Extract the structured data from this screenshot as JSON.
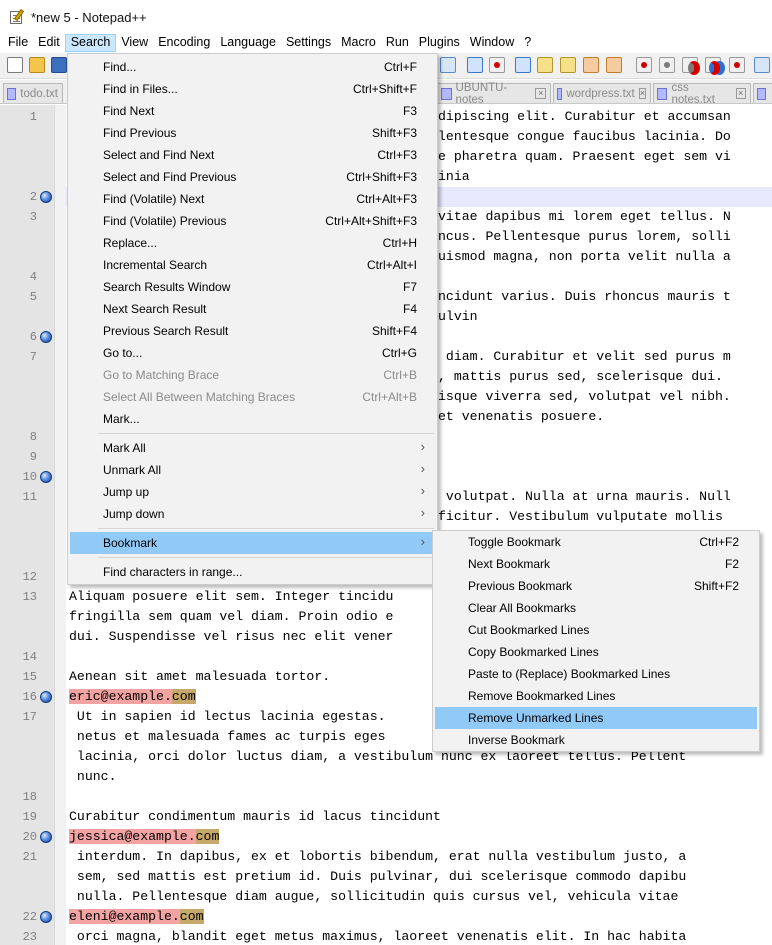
{
  "window": {
    "title": "*new 5 - Notepad++"
  },
  "menubar": [
    "File",
    "Edit",
    "Search",
    "View",
    "Encoding",
    "Language",
    "Settings",
    "Macro",
    "Run",
    "Plugins",
    "Window",
    "?"
  ],
  "tabs": [
    "todo.txt",
    "UBUNTU-notes",
    "wordpress.txt",
    "css notes.txt"
  ],
  "search_menu": {
    "items": [
      {
        "label": "Find...",
        "shortcut": "Ctrl+F"
      },
      {
        "label": "Find in Files...",
        "shortcut": "Ctrl+Shift+F"
      },
      {
        "label": "Find Next",
        "shortcut": "F3"
      },
      {
        "label": "Find Previous",
        "shortcut": "Shift+F3"
      },
      {
        "label": "Select and Find Next",
        "shortcut": "Ctrl+F3"
      },
      {
        "label": "Select and Find Previous",
        "shortcut": "Ctrl+Shift+F3"
      },
      {
        "label": "Find (Volatile) Next",
        "shortcut": "Ctrl+Alt+F3"
      },
      {
        "label": "Find (Volatile) Previous",
        "shortcut": "Ctrl+Alt+Shift+F3"
      },
      {
        "label": "Replace...",
        "shortcut": "Ctrl+H"
      },
      {
        "label": "Incremental Search",
        "shortcut": "Ctrl+Alt+I"
      },
      {
        "label": "Search Results Window",
        "shortcut": "F7"
      },
      {
        "label": "Next Search Result",
        "shortcut": "F4"
      },
      {
        "label": "Previous Search Result",
        "shortcut": "Shift+F4"
      },
      {
        "label": "Go to...",
        "shortcut": "Ctrl+G"
      },
      {
        "label": "Go to Matching Brace",
        "shortcut": "Ctrl+B"
      },
      {
        "label": "Select All Between Matching Braces",
        "shortcut": "Ctrl+Alt+B"
      },
      {
        "label": "Mark...",
        "shortcut": ""
      },
      {
        "label": "Mark All",
        "shortcut": ""
      },
      {
        "label": "Unmark All",
        "shortcut": ""
      },
      {
        "label": "Jump up",
        "shortcut": ""
      },
      {
        "label": "Jump down",
        "shortcut": ""
      },
      {
        "label": "Bookmark",
        "shortcut": ""
      },
      {
        "label": "Find characters in range...",
        "shortcut": ""
      }
    ]
  },
  "bookmark_submenu": {
    "items": [
      {
        "label": "Toggle Bookmark",
        "shortcut": "Ctrl+F2"
      },
      {
        "label": "Next Bookmark",
        "shortcut": "F2"
      },
      {
        "label": "Previous Bookmark",
        "shortcut": "Shift+F2"
      },
      {
        "label": "Clear All Bookmarks",
        "shortcut": ""
      },
      {
        "label": "Cut Bookmarked Lines",
        "shortcut": ""
      },
      {
        "label": "Copy Bookmarked Lines",
        "shortcut": ""
      },
      {
        "label": "Paste to (Replace) Bookmarked Lines",
        "shortcut": ""
      },
      {
        "label": "Remove Bookmarked Lines",
        "shortcut": ""
      },
      {
        "label": "Remove Unmarked Lines",
        "shortcut": ""
      },
      {
        "label": "Inverse Bookmark",
        "shortcut": ""
      }
    ]
  },
  "editor": {
    "line_numbers": [
      "1",
      "2",
      "3",
      "4",
      "5",
      "6",
      "7",
      "8",
      "9",
      "10",
      "11",
      "12",
      "13",
      "14",
      "15",
      "16",
      "17",
      "18",
      "19",
      "20",
      "21",
      "22",
      "23"
    ],
    "code": {
      "l1a": "dipiscing elit. Curabitur et accumsan",
      "l1b": "lentesque congue faucibus lacinia. Do",
      "l1c": "e pharetra quam. Praesent eget sem vi",
      "l1d": "inia",
      "l3a": "vitae dapibus mi lorem eget tellus. N",
      "l3b": "ncus. Pellentesque purus lorem, solli",
      "l3c": "uismod magna, non porta velit nulla a",
      "l5a": "ncidunt varius. Duis rhoncus mauris t",
      "l5b": "ulvin",
      "l7a": " diam. Curabitur et velit sed purus m",
      "l7b": ", mattis purus sed, scelerisque dui. ",
      "l7c": "isque viverra sed, volutpat vel nibh.",
      "l7d": "et venenatis posuere.",
      "l11a": " volutpat. Nulla at urna mauris. Null",
      "l11b": "ficitur. Vestibulum vulputate mollis ",
      "l13a": "Aliquam posuere elit sem. Integer tincidu",
      "l13b": "fringilla sem quam vel diam. Proin odio e",
      "l13c": "dui. Suspendisse vel risus nec elit vener",
      "l15": "Aenean sit amet malesuada tortor.",
      "l16_user": "eric@example.",
      "l16_tld": "com",
      "l17a": " Ut in sapien id lectus lacinia egestas.",
      "l17b": " netus et malesuada fames ac turpis eges",
      "l17c": " lacinia, orci dolor luctus diam, a vestibulum nunc ex laoreet tellus. Pellent",
      "l17d": " nunc.",
      "l19": "Curabitur condimentum mauris id lacus tincidunt",
      "l20_user": "jessica@example.",
      "l20_tld": "com",
      "l21a": " interdum. In dapibus, ex et lobortis bibendum, erat nulla vestibulum justo, a",
      "l21b": " sem, sed mattis est pretium id. Duis pulvinar, dui scelerisque commodo dapibu",
      "l21c": " nulla. Pellentesque diam augue, sollicitudin quis cursus vel, vehicula vitae",
      "l22_user": "eleni@example.",
      "l22_tld": "com",
      "l23": " orci magna, blandit eget metus maximus, laoreet venenatis elit. In hac habita"
    }
  },
  "colors": {
    "menu_hover": "#91c9f7",
    "bookmark_blue": "#5a8fe0",
    "highlight_red": "#f4a3a3",
    "highlight_tan": "#c6a86a"
  }
}
